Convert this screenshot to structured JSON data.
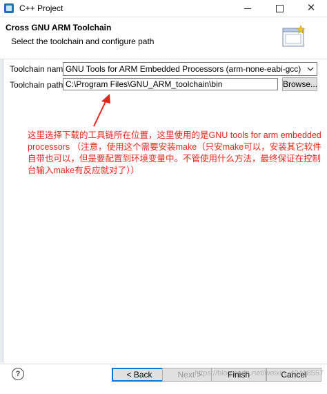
{
  "window": {
    "title": "C++ Project",
    "icon": "eclipse-cdt-icon"
  },
  "header": {
    "title": "Cross GNU ARM Toolchain",
    "description": "Select the toolchain and configure path",
    "icon": "wizard-banner-icon"
  },
  "toolchain": {
    "name_label": "Toolchain name:",
    "name_value": "GNU Tools for ARM Embedded Processors (arm-none-eabi-gcc)",
    "path_label": "Toolchain path:",
    "path_value": "C:\\Program Files\\GNU_ARM_toolchain\\bin",
    "browse_label": "Browse..."
  },
  "annotation": {
    "color": "#e8231a",
    "lines": [
      "这里选择下载的工具链所在位置，这里使用的是GNU tools for arm embedded",
      " processors （注意，使用这个需要安装make（只安make可以，安装其它软件",
      "自带也可以，但是要配置到环境变量中。不管使用什么方法，最终保证在控制",
      "台输入make有反应就对了））"
    ]
  },
  "footer": {
    "help_icon": "?",
    "back_label": "< Back",
    "next_label": "Next >",
    "finish_label": "Finish",
    "cancel_label": "Cancel",
    "watermark": "https://blog.csdn.net/weixin_42418557"
  },
  "colors": {
    "accent": "#0078d7",
    "annotation": "#e8231a"
  }
}
